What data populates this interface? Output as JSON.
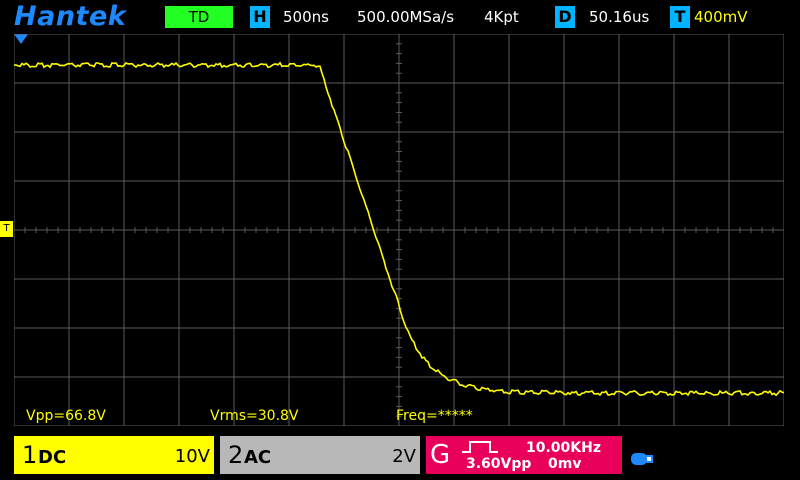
{
  "header": {
    "brand": "Hantek",
    "mode": "TD",
    "horizontal": {
      "tag": "H",
      "timebase": "500ns",
      "sample_rate": "500.00MSa/s",
      "memory": "4Kpt"
    },
    "delay": {
      "tag": "D",
      "value": "50.16us"
    },
    "trigger": {
      "tag": "T",
      "value": "400mV"
    }
  },
  "measurements": {
    "vpp": "Vpp=66.8V",
    "vrms": "Vrms=30.8V",
    "freq": "Freq=*****"
  },
  "channels": [
    {
      "num": "1",
      "coupling": "DC",
      "scale": "10V",
      "color": "#ffff00"
    },
    {
      "num": "2",
      "coupling": "AC",
      "scale": "2V",
      "color": "#b8b8b8"
    }
  ],
  "generator": {
    "letter": "G",
    "frequency": "10.00KHz",
    "amplitude": "3.60Vpp",
    "offset": "0mv",
    "color": "#e8005a"
  },
  "trigger_level_marker": "T",
  "colors": {
    "trace": "#ffff00",
    "grid": "#5a5a5a",
    "brand": "#1e88ff",
    "mode": "#22ff22",
    "tag": "#00b4ff"
  },
  "icons": [
    "usb-icon"
  ]
}
